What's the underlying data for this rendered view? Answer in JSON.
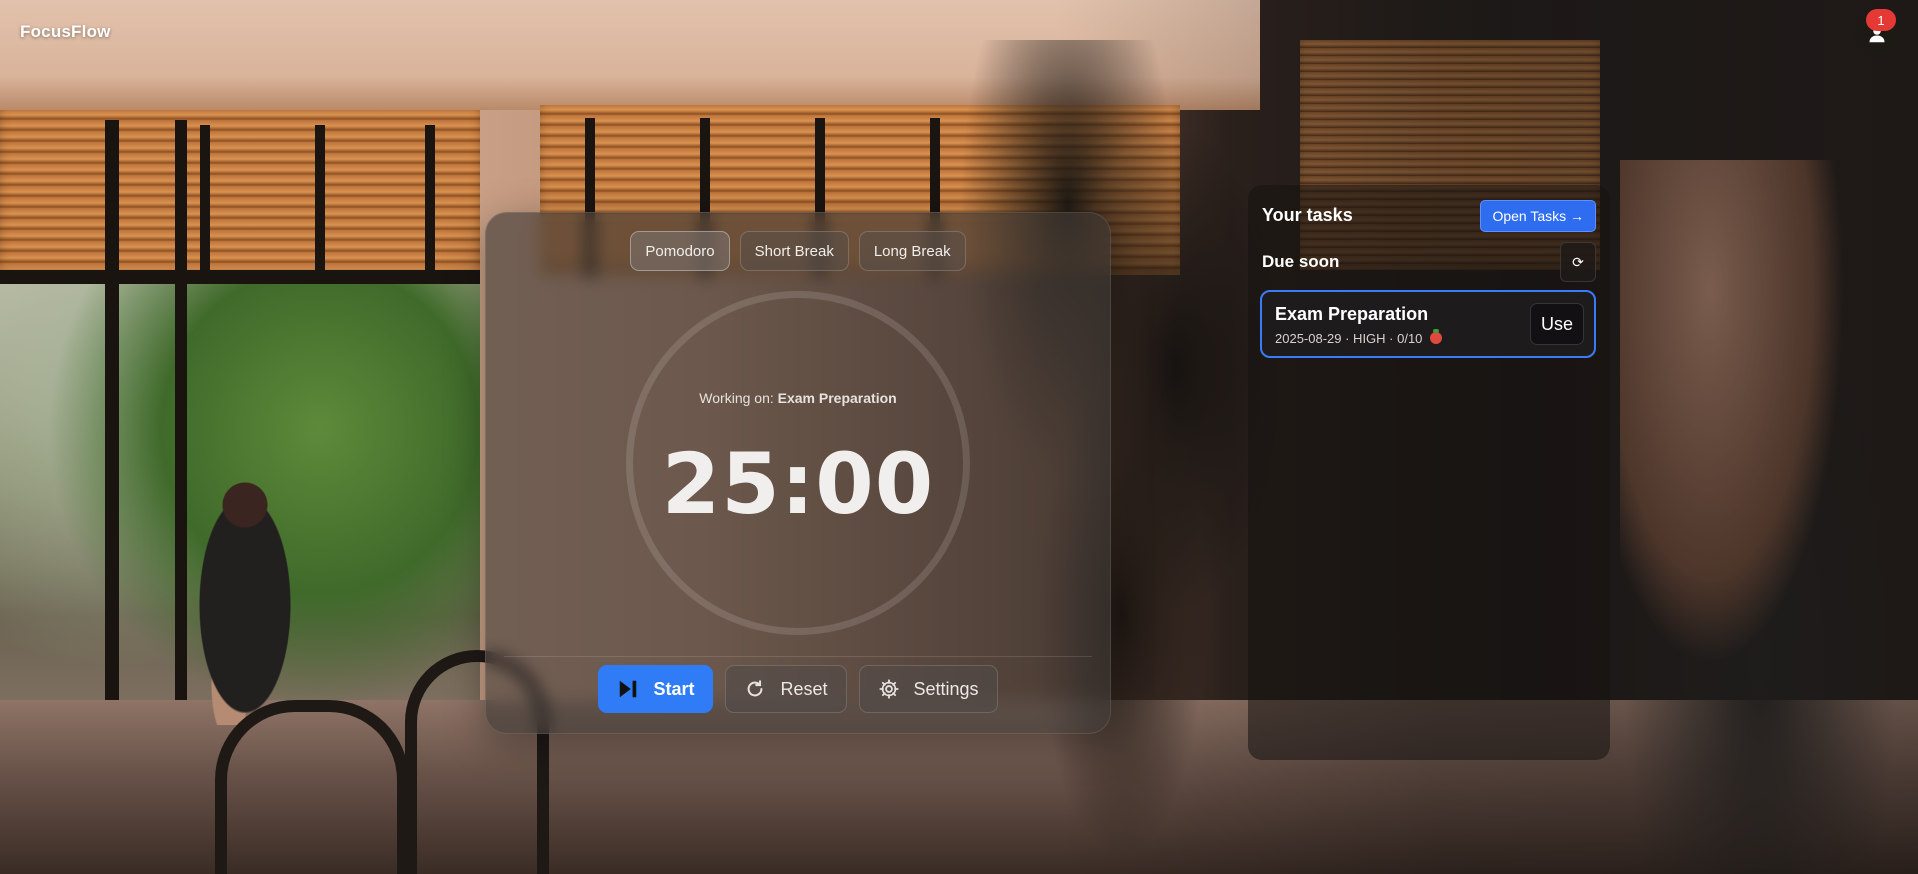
{
  "app": {
    "brand": "FocusFlow"
  },
  "notifications": {
    "count": "1"
  },
  "timer": {
    "modes": [
      "Pomodoro",
      "Short Break",
      "Long Break"
    ],
    "active_mode": "Pomodoro",
    "working_prefix": "Working on:",
    "working_task": "Exam Preparation",
    "time": "25:00",
    "controls": {
      "start": "Start",
      "reset": "Reset",
      "settings": "Settings"
    }
  },
  "tasks": {
    "title": "Your tasks",
    "open_button": "Open Tasks →",
    "due_title": "Due soon",
    "refresh_icon": "⟳",
    "items": [
      {
        "name": "Exam Preparation",
        "meta": "2025-08-29 · HIGH · 0/10",
        "use_label": "Use"
      }
    ]
  },
  "colors": {
    "accent": "#2f7cf6",
    "badge": "#e53935"
  }
}
